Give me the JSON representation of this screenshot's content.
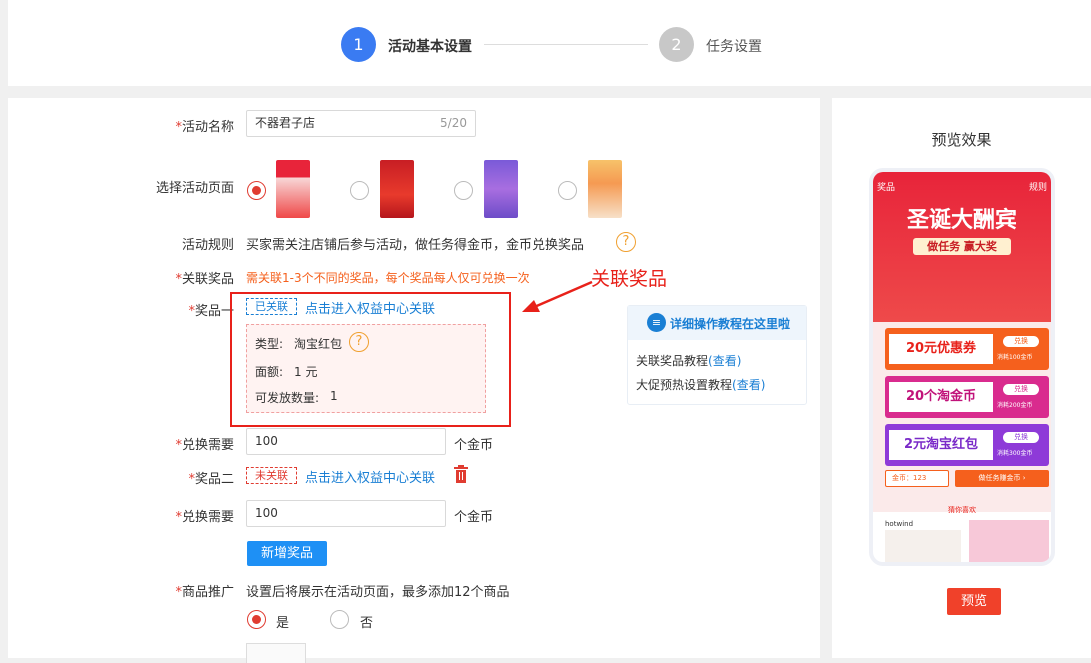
{
  "steps": [
    {
      "num": "1",
      "label": "活动基本设置"
    },
    {
      "num": "2",
      "label": "任务设置"
    }
  ],
  "form": {
    "name_label": "活动名称",
    "name_value": "不器君子店",
    "name_count": "5/20",
    "page_label": "选择活动页面",
    "rules_label": "活动规则",
    "rules_text": "买家需关注店铺后参与活动，做任务得金币，金币兑换奖品",
    "prize_label": "关联奖品",
    "prize_hint": "需关联1-3个不同的奖品，每个奖品每人仅可兑换一次",
    "prize1_label": "奖品一",
    "prize1_tag": "已关联",
    "prize1_link": "点击进入权益中心关联",
    "detail_type_label": "类型:",
    "detail_type_value": "淘宝红包",
    "detail_amount_label": "面额:",
    "detail_amount_value": "1 元",
    "detail_qty_label": "可发放数量:",
    "detail_qty_value": "1",
    "exchange1_label": "兑换需要",
    "exchange1_value": "100",
    "unit1": "个金币",
    "prize2_label": "奖品二",
    "prize2_tag": "未关联",
    "prize2_link": "点击进入权益中心关联",
    "exchange2_label": "兑换需要",
    "exchange2_value": "100",
    "unit2": "个金币",
    "add_prize": "新增奖品",
    "promo_label": "商品推广",
    "promo_text": "设置后将展示在活动页面，最多添加12个商品",
    "yes": "是",
    "no": "否"
  },
  "annotation": "关联奖品",
  "tutorial": {
    "title": "详细操作教程在这里啦",
    "link1_pre": "关联奖品教程",
    "link1": "(查看)",
    "link2_pre": "大促预热设置教程",
    "link2": "(查看)"
  },
  "preview": {
    "title": "预览效果",
    "button": "预览",
    "phone": {
      "top_left": "奖品",
      "top_right": "规则",
      "banner": "圣诞大酬宾",
      "sub1": "做任务",
      "sub2": "赢大奖",
      "coupons": [
        {
          "text": "20元优惠券",
          "btn": "兑换",
          "cost": "消耗100金币"
        },
        {
          "text": "20个淘金币",
          "btn": "兑换",
          "cost": "消耗200金币"
        },
        {
          "text": "2元淘宝红包",
          "btn": "兑换",
          "cost": "消耗300金币"
        }
      ],
      "coin": "金币：123",
      "task_btn": "做任务赚金币 ›",
      "guess": "猜你喜欢",
      "brand": "hotwind"
    }
  },
  "colors": {
    "accent": "#3a7bf2",
    "red": "#e03c31",
    "blue": "#1a7fd4",
    "warn": "#f5601d"
  }
}
